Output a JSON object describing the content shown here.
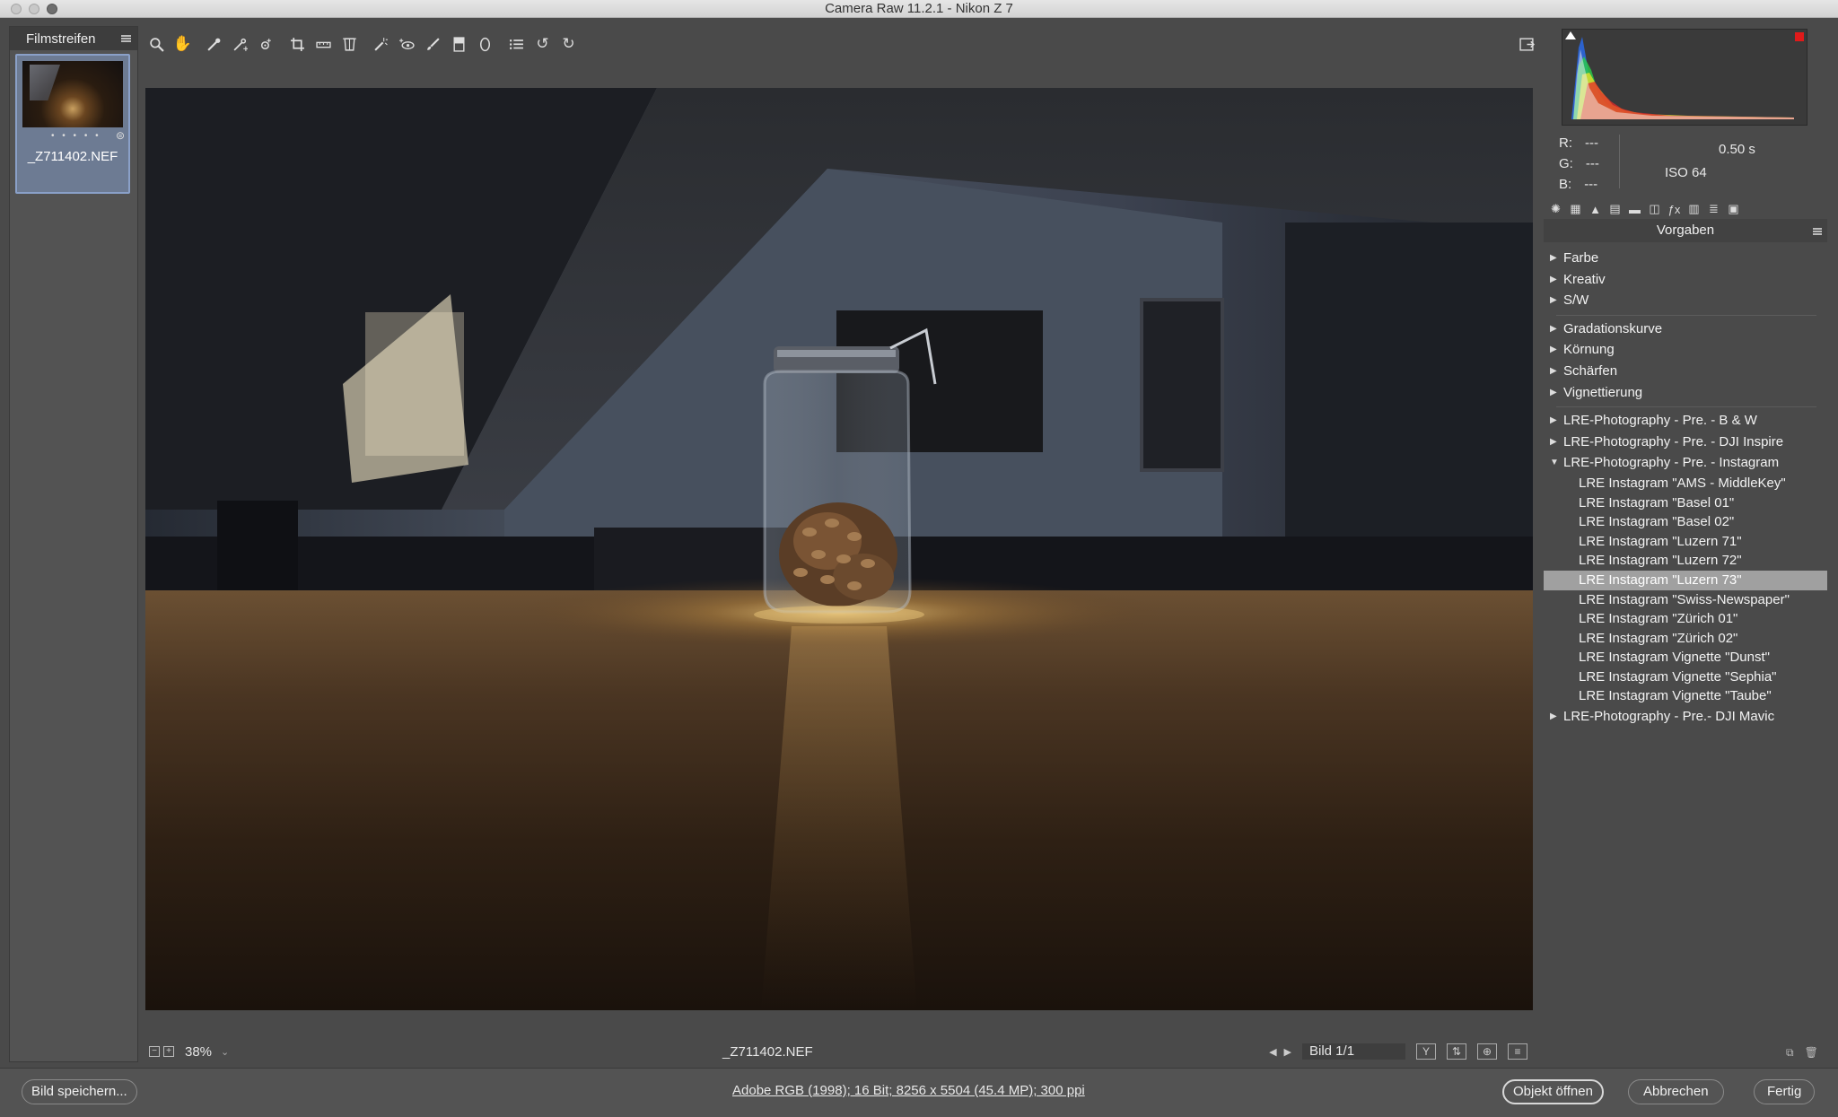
{
  "window": {
    "title": "Camera Raw 11.2.1 - Nikon Z 7"
  },
  "filmstrip": {
    "header": "Filmstreifen",
    "items": [
      {
        "filename": "_Z711402.NEF",
        "rating_dots": "• • • • •"
      }
    ]
  },
  "toolbar": {
    "tools": [
      "zoom-icon",
      "hand-icon",
      "white-balance-icon",
      "color-sampler-icon",
      "targeted-adjustment-icon",
      "crop-icon",
      "straighten-icon",
      "transform-icon",
      "spot-removal-icon",
      "red-eye-icon",
      "adjustment-brush-icon",
      "graduated-filter-icon",
      "radial-filter-icon",
      "preferences-icon",
      "rotate-left-icon",
      "rotate-right-icon"
    ],
    "right_tool": "fullscreen-icon"
  },
  "preview": {
    "zoom": "38%",
    "filename": "_Z711402.NEF",
    "image_counter": "Bild 1/1"
  },
  "histogram": {
    "readout": {
      "r": "R:",
      "g": "G:",
      "b": "B:",
      "value": "---"
    },
    "shutter": "0.50 s",
    "iso": "ISO 64"
  },
  "presets_panel": {
    "title": "Vorgaben",
    "groups": [
      [
        "Farbe",
        "Kreativ",
        "S/W"
      ],
      [
        "Gradationskurve",
        "Körnung",
        "Schärfen",
        "Vignettierung"
      ]
    ],
    "lre_groups": {
      "bw": "LRE-Photography - Pre. - B & W",
      "inspire": "LRE-Photography - Pre. - DJI Inspire",
      "instagram": "LRE-Photography - Pre. - Instagram",
      "mavic": "LRE-Photography - Pre.- DJI Mavic"
    },
    "instagram_children": [
      "LRE Instagram \"AMS - MiddleKey\"",
      "LRE Instagram \"Basel 01\"",
      "LRE Instagram \"Basel 02\"",
      "LRE Instagram \"Luzern 71\"",
      "LRE Instagram \"Luzern 72\"",
      "LRE Instagram \"Luzern 73\"",
      "LRE Instagram \"Swiss-Newspaper\"",
      "LRE Instagram \"Zürich 01\"",
      "LRE Instagram \"Zürich 02\"",
      "LRE Instagram Vignette \"Dunst\"",
      "LRE Instagram Vignette \"Sephia\"",
      "LRE Instagram Vignette \"Taube\""
    ],
    "selected": "LRE Instagram \"Luzern 73\""
  },
  "bottom_bar": {
    "save_label": "Bild speichern...",
    "workflow_info": "Adobe RGB (1998); 16 Bit; 8256 x 5504 (45.4 MP); 300 ppi",
    "open_label": "Objekt öffnen",
    "cancel_label": "Abbrechen",
    "done_label": "Fertig"
  }
}
